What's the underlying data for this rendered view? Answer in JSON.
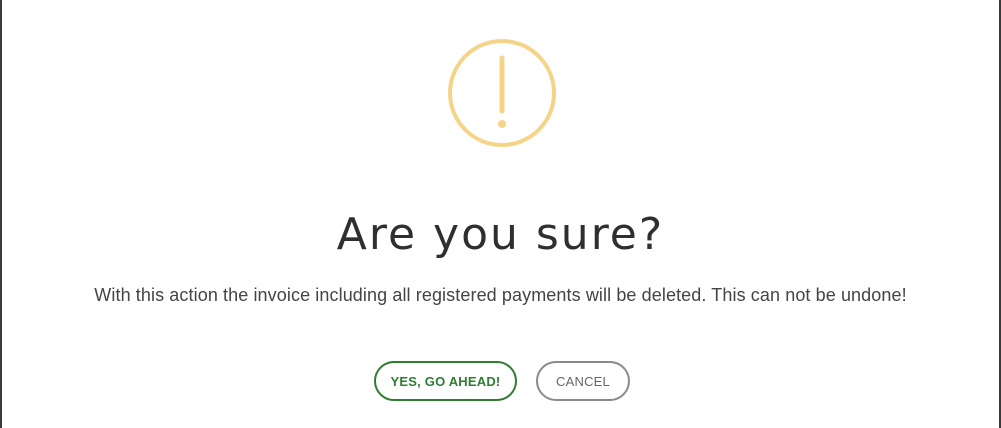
{
  "dialog": {
    "icon": "warning-exclamation-icon",
    "icon_color": "#f5d48a",
    "title": "Are you sure?",
    "message": "With this action the invoice including all registered payments will be deleted. This can not be undone!",
    "confirm_label": "YES, GO AHEAD!",
    "cancel_label": "CANCEL",
    "confirm_color": "#2e7d32",
    "cancel_color": "#8a8a8a"
  }
}
